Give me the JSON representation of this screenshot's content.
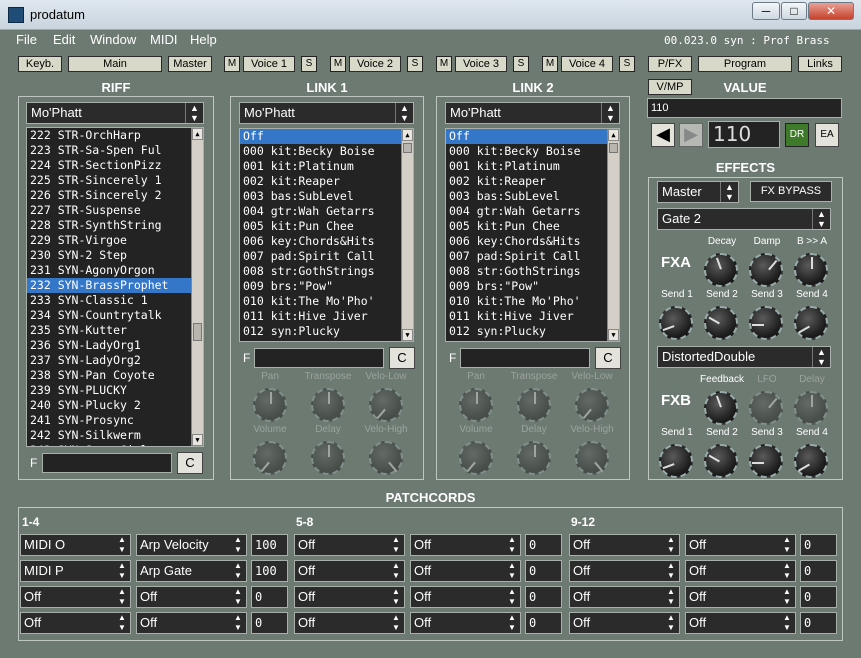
{
  "window": {
    "title": "prodatum",
    "minimize": "─",
    "maximize": "□",
    "close": "✕"
  },
  "menu": [
    "File",
    "Edit",
    "Window",
    "MIDI",
    "Help"
  ],
  "status": "00.023.0 syn : Prof Brass",
  "toolbar": {
    "keyb": "Keyb.",
    "main": "Main",
    "master": "Master",
    "voices": [
      {
        "m": "M",
        "label": "Voice 1",
        "s": "S"
      },
      {
        "m": "M",
        "label": "Voice 2",
        "s": "S"
      },
      {
        "m": "M",
        "label": "Voice 3",
        "s": "S"
      },
      {
        "m": "M",
        "label": "Voice 4",
        "s": "S"
      }
    ],
    "pfx": "P/FX",
    "program": "Program",
    "links": "Links",
    "vmp": "V/MP"
  },
  "riff": {
    "title": "RIFF",
    "rom": "Mo'Phatt",
    "filter_label": "F",
    "clear": "C",
    "items": [
      "222 STR-OrchHarp",
      "223 STR-Sa-Spen Ful",
      "224 STR-SectionPizz",
      "225 STR-Sincerely 1",
      "226 STR-Sincerely 2",
      "227 STR-Suspense",
      "228 STR-SynthString",
      "229 STR-Virgoe",
      "230 SYN-2 Step",
      "231 SYN-AgonyOrgon",
      "232 SYN-BrassProphet",
      "233 SYN-Classic 1",
      "234 SYN-Countrytalk",
      "235 SYN-Kutter",
      "236 SYN-LadyOrg1",
      "237 SYN-LadyOrg2",
      "238 SYN-Pan Coyote",
      "239 SYN-PLUCKY",
      "240 SYN-Plucky 2",
      "241 SYN-Prosync",
      "242 SYN-Silkwerm",
      "243 SYN-Sync Girl"
    ],
    "selected": 10
  },
  "links": [
    {
      "title": "LINK 1",
      "rom": "Mo'Phatt",
      "filter_label": "F",
      "clear": "C",
      "items": [
        "Off",
        "000 kit:Becky Boise",
        "001 kit:Platinum",
        "002 kit:Reaper",
        "003 bas:SubLevel",
        "004 gtr:Wah Getarrs",
        "005 kit:Pun Chee",
        "006 key:Chords&Hits",
        "007 pad:Spirit Call",
        "008 str:GothStrings",
        "009 brs:\"Pow\"",
        "010 kit:The Mo'Pho'",
        "011 kit:Hive Jiver",
        "012 syn:Plucky"
      ],
      "knobs": [
        "Pan",
        "Transpose",
        "Velo-Low",
        "Volume",
        "Delay",
        "Velo-High"
      ]
    },
    {
      "title": "LINK 2",
      "rom": "Mo'Phatt",
      "filter_label": "F",
      "clear": "C",
      "items": [
        "Off",
        "000 kit:Becky Boise",
        "001 kit:Platinum",
        "002 kit:Reaper",
        "003 bas:SubLevel",
        "004 gtr:Wah Getarrs",
        "005 kit:Pun Chee",
        "006 key:Chords&Hits",
        "007 pad:Spirit Call",
        "008 str:GothStrings",
        "009 brs:\"Pow\"",
        "010 kit:The Mo'Pho'",
        "011 kit:Hive Jiver",
        "012 syn:Plucky"
      ],
      "knobs": [
        "Pan",
        "Transpose",
        "Velo-Low",
        "Volume",
        "Delay",
        "Velo-High"
      ]
    }
  ],
  "value": {
    "title": "VALUE",
    "text": "110",
    "display": "110",
    "dr": "DR",
    "ea": "EA"
  },
  "effects": {
    "title": "EFFECTS",
    "master": "Master",
    "bypass": "FX BYPASS",
    "gate": "Gate 2",
    "fxa": "FXA",
    "fxa_top": [
      "Decay",
      "Damp",
      "B >> A"
    ],
    "fxa_sends": [
      "Send 1",
      "Send 2",
      "Send 3",
      "Send 4"
    ],
    "fxb_type": "DistortedDouble",
    "fxb": "FXB",
    "fxb_top": [
      "Feedback",
      "LFO",
      "Delay"
    ],
    "fxb_sends": [
      "Send 1",
      "Send 2",
      "Send 3",
      "Send 4"
    ]
  },
  "patchcords": {
    "title": "PATCHCORDS",
    "groups": [
      {
        "label": "1-4",
        "rows": [
          [
            "MIDI O",
            "Arp Velocity",
            "100"
          ],
          [
            "MIDI P",
            "Arp Gate",
            "100"
          ],
          [
            "Off",
            "Off",
            "0"
          ],
          [
            "Off",
            "Off",
            "0"
          ]
        ]
      },
      {
        "label": "5-8",
        "rows": [
          [
            "Off",
            "Off",
            "0"
          ],
          [
            "Off",
            "Off",
            "0"
          ],
          [
            "Off",
            "Off",
            "0"
          ],
          [
            "Off",
            "Off",
            "0"
          ]
        ]
      },
      {
        "label": "9-12",
        "rows": [
          [
            "Off",
            "Off",
            "0"
          ],
          [
            "Off",
            "Off",
            "0"
          ],
          [
            "Off",
            "Off",
            "0"
          ],
          [
            "Off",
            "Off",
            "0"
          ]
        ]
      }
    ]
  },
  "colors": {
    "background": "#6d7a72",
    "list_bg": "#232323",
    "selection": "#3476c7",
    "dr_green": "#3f7a2a"
  }
}
